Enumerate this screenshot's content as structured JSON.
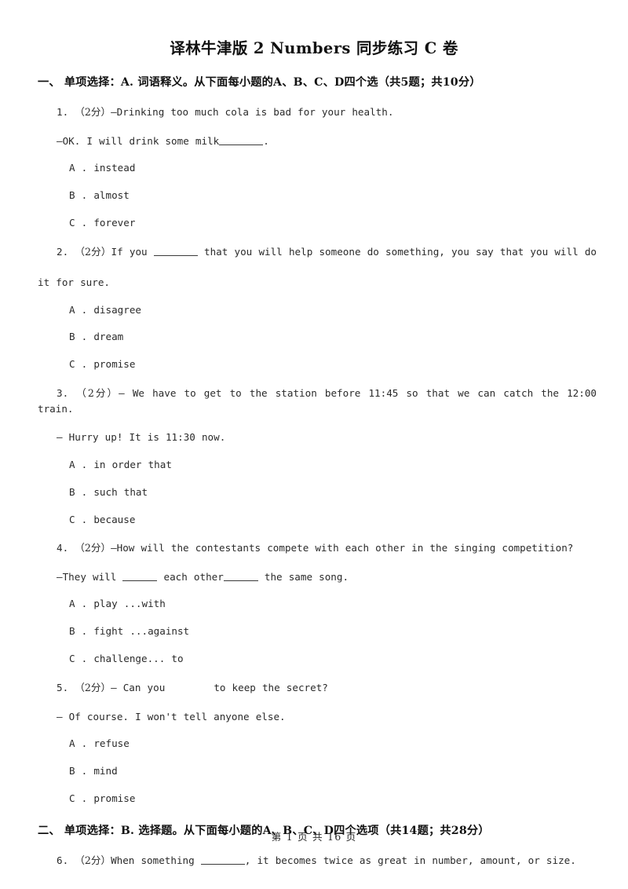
{
  "document": {
    "title": "译林牛津版 2 Numbers 同步练习 C 卷",
    "footer": "第 1 页 共 16 页"
  },
  "sections": [
    {
      "heading": "一、 单项选择：A. 词语释义。从下面每小题的A、B、C、D四个选（共5题；共10分）",
      "questions": [
        {
          "number": "1.",
          "score": "（2分）",
          "stem_before": "—Drinking too much cola is bad for your health.",
          "sub_before": "—OK. I will drink some milk",
          "sub_after": ".",
          "options": [
            "A . instead",
            "B . almost",
            "C . forever"
          ]
        },
        {
          "number": "2.",
          "score": "（2分）",
          "stem_before": "If you ",
          "stem_after": " that you will help someone do something, you say that you will do",
          "stem_wrap": "it for sure.",
          "options": [
            "A . disagree",
            "B . dream",
            "C . promise"
          ]
        },
        {
          "number": "3.",
          "score": "（2分）",
          "stem_before": "— We have to get to the station before 11:45 so that we can catch the 12:00 train.",
          "sub_before": "— Hurry up! It is 11:30 now.",
          "options": [
            "A . in order that",
            "B . such that",
            "C . because"
          ]
        },
        {
          "number": "4.",
          "score": "（2分）",
          "stem_before": "—How will the contestants compete with each other in the singing competition?",
          "sub_before": "—They will ",
          "sub_middle": " each other",
          "sub_after": " the same song.",
          "options": [
            "A . play ...with",
            "B . fight ...against",
            "C . challenge... to"
          ]
        },
        {
          "number": "5.",
          "score": "（2分）",
          "stem_before": "— Can you",
          "stem_after": "to keep the secret?",
          "sub_before": "— Of course. I won't tell anyone else.",
          "options": [
            "A . refuse",
            "B . mind",
            "C . promise"
          ]
        }
      ]
    },
    {
      "heading": "二、 单项选择：B. 选择题。从下面每小题的A、B、C、D四个选项（共14题；共28分）",
      "questions": [
        {
          "number": "6.",
          "score": "（2分）",
          "stem_before": "When something ",
          "stem_after": ", it becomes twice as great in number, amount, or size."
        }
      ]
    }
  ]
}
